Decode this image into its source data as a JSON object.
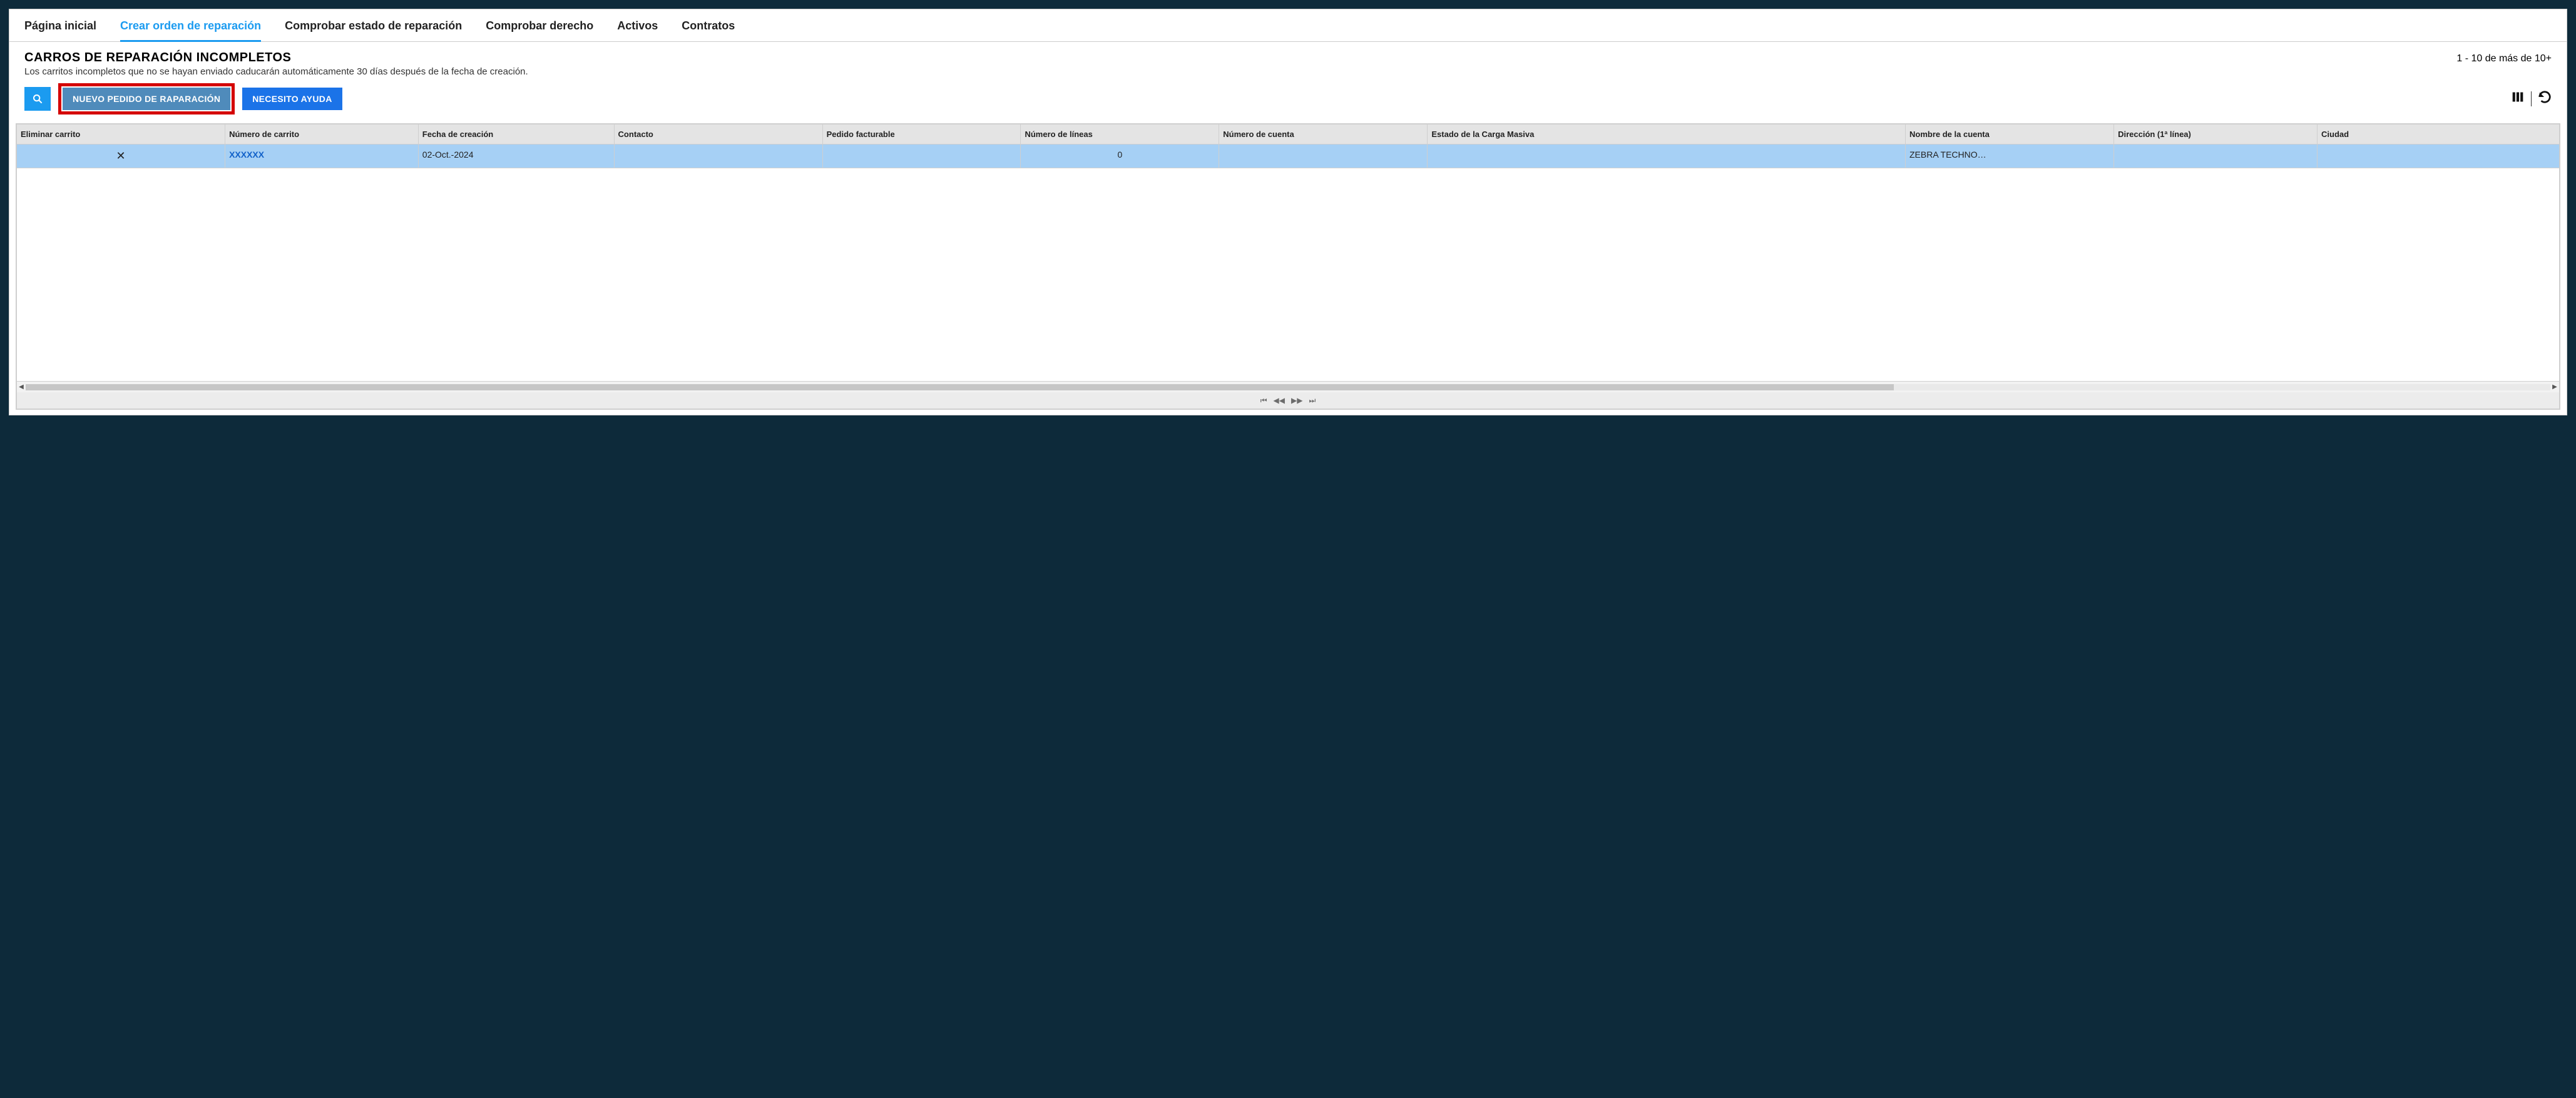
{
  "tabs": [
    {
      "label": "Página inicial",
      "active": false
    },
    {
      "label": "Crear orden de reparación",
      "active": true
    },
    {
      "label": "Comprobar estado de reparación",
      "active": false
    },
    {
      "label": "Comprobar derecho",
      "active": false
    },
    {
      "label": "Activos",
      "active": false
    },
    {
      "label": "Contratos",
      "active": false
    }
  ],
  "section": {
    "title": "CARROS DE REPARACIÓN INCOMPLETOS",
    "subtitle": "Los carritos incompletos que no se hayan enviado caducarán automáticamente 30 días después de la fecha de creación.",
    "range": "1 - 10 de más de 10+"
  },
  "toolbar": {
    "new_repair_label": "NUEVO PEDIDO DE RAPARACIÓN",
    "help_label": "NECESITO AYUDA"
  },
  "columns": [
    "Eliminar carrito",
    "Número de carrito",
    "Fecha de creación",
    "Contacto",
    "Pedido facturable",
    "Número de líneas",
    "Número de cuenta",
    "Estado de la Carga Masiva",
    "Nombre de la cuenta",
    "Dirección (1ª línea)",
    "Ciudad"
  ],
  "rows": [
    {
      "delete_icon": "✕",
      "cart_number": "XXXXXX",
      "created": "02-Oct.-2024",
      "contact": "",
      "billable": "",
      "lines": "0",
      "account_no": "",
      "bulk_status": "",
      "account_name": "ZEBRA TECHNO…",
      "address": "",
      "city": ""
    }
  ]
}
